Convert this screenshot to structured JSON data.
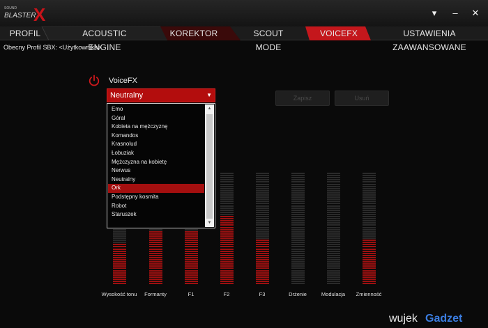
{
  "app": {
    "logo_small": "SOUND",
    "logo_text": "BLASTER",
    "logo_x": "X"
  },
  "window_controls": [
    "▾",
    "–",
    "✕"
  ],
  "tabs": [
    {
      "label": "PROFIL",
      "active": false
    },
    {
      "label": "ACOUSTIC ENGINE",
      "active": false
    },
    {
      "label": "KOREKTOR",
      "active": false
    },
    {
      "label": "SCOUT MODE",
      "active": false
    },
    {
      "label": "VOICEFX",
      "active": true
    },
    {
      "label": "USTAWIENIA ZAAWANSOWANE",
      "active": false
    }
  ],
  "profile_line": "Obecny Profil SBX: <Użytkownika>",
  "voicefx": {
    "label": "VoiceFX",
    "power_icon": "power-icon",
    "selected": "Neutralny",
    "options": [
      "Emo",
      "Góral",
      "Kobieta na mężczyznę",
      "Komandos",
      "Krasnolud",
      "Łobuziak",
      "Mężczyzna na kobietę",
      "Nerwus",
      "Neutralny",
      "Ork",
      "Podstępny kosmita",
      "Robot",
      "Staruszek"
    ],
    "highlighted": "Ork"
  },
  "buttons": {
    "save": "Zapisz",
    "delete": "Usuń"
  },
  "meters": [
    {
      "label": "Wysokość tonu",
      "level": 0.36
    },
    {
      "label": "Formanty",
      "level": 0.48
    },
    {
      "label": "F1",
      "level": 0.48
    },
    {
      "label": "F2",
      "level": 0.61
    },
    {
      "label": "F3",
      "level": 0.4
    },
    {
      "label": "Drżenie",
      "level": 0.0
    },
    {
      "label": "Modulacja",
      "level": 0.0
    },
    {
      "label": "Zmienność",
      "level": 0.4
    }
  ],
  "colors": {
    "accent": "#b30d0d",
    "segment_off": "#2a2a2a",
    "segment_on": "#9c1010"
  },
  "watermark": {
    "text_a": "wujek",
    "text_b": "Gadzet"
  }
}
